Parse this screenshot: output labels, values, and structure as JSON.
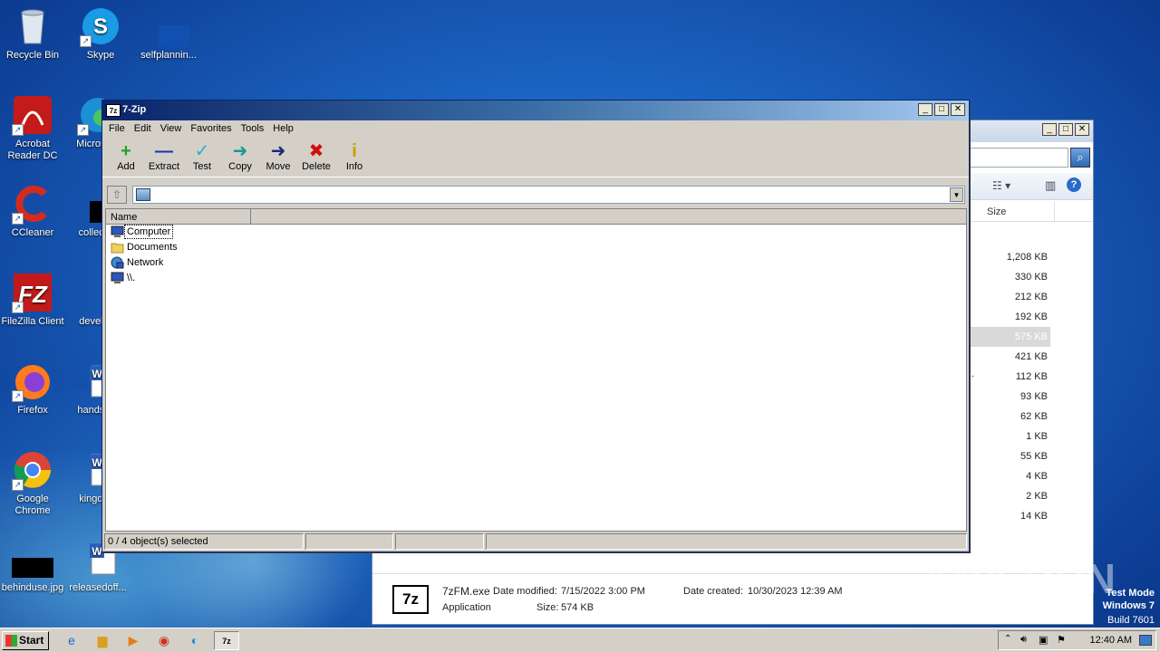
{
  "desktop": {
    "icons": [
      {
        "label": "Recycle Bin"
      },
      {
        "label": "Skype"
      },
      {
        "label": "selfplannin..."
      },
      {
        "label": "Acrobat Reader DC"
      },
      {
        "label": "Microso..."
      },
      {
        "label": "CCleaner"
      },
      {
        "label": "collecti..."
      },
      {
        "label": "FileZilla Client"
      },
      {
        "label": "develo..."
      },
      {
        "label": "Firefox"
      },
      {
        "label": "handsp..."
      },
      {
        "label": "Google Chrome"
      },
      {
        "label": "kingdo..."
      },
      {
        "label": "behinduse.jpg"
      },
      {
        "label": "releasedoff..."
      }
    ]
  },
  "explorer": {
    "column_size": "Size",
    "sizes": [
      "1,208 KB",
      "330 KB",
      "212 KB",
      "192 KB",
      "575 KB",
      "421 KB",
      "112 KB",
      "93 KB",
      "62 KB",
      "1 KB",
      "55 KB",
      "4 KB",
      "2 KB",
      "14 KB"
    ],
    "selected_index": 4,
    "truncated_mark": "..",
    "details": {
      "icon_text": "7z",
      "filename": "7zFM.exe",
      "modified_label": "Date modified:",
      "modified_value": "7/15/2022 3:00 PM",
      "created_label": "Date created:",
      "created_value": "10/30/2023 12:39 AM",
      "type": "Application",
      "size_label": "Size:",
      "size_value": "574 KB"
    }
  },
  "zip": {
    "title": "7-Zip",
    "title_icon": "7z",
    "menu": [
      "File",
      "Edit",
      "View",
      "Favorites",
      "Tools",
      "Help"
    ],
    "toolbar": [
      {
        "label": "Add",
        "icon": "add-icon",
        "glyph": "+",
        "color": "#1fa51f"
      },
      {
        "label": "Extract",
        "icon": "extract-icon",
        "glyph": "—",
        "color": "#1a2fb4"
      },
      {
        "label": "Test",
        "icon": "test-icon",
        "glyph": "✓",
        "color": "#22b7c7"
      },
      {
        "label": "Copy",
        "icon": "copy-icon",
        "glyph": "➜",
        "color": "#1a9a8a"
      },
      {
        "label": "Move",
        "icon": "move-icon",
        "glyph": "➜",
        "color": "#1a2a7a"
      },
      {
        "label": "Delete",
        "icon": "delete-icon",
        "glyph": "✖",
        "color": "#d01010"
      },
      {
        "label": "Info",
        "icon": "info-icon",
        "glyph": "i",
        "color": "#c8a000"
      }
    ],
    "list_header": "Name",
    "items": [
      {
        "name": "Computer",
        "icon": "computer-icon"
      },
      {
        "name": "Documents",
        "icon": "folder-icon"
      },
      {
        "name": "Network",
        "icon": "network-icon"
      },
      {
        "name": "\\\\.",
        "icon": "computer-icon"
      }
    ],
    "status": "0 / 4 object(s) selected"
  },
  "taskbar": {
    "start": "Start",
    "clock": "12:40 AM"
  },
  "watermark": "ANY RUN",
  "testmode": {
    "line1": "Test Mode",
    "line2": "Windows 7",
    "line3": "Build 7601"
  }
}
